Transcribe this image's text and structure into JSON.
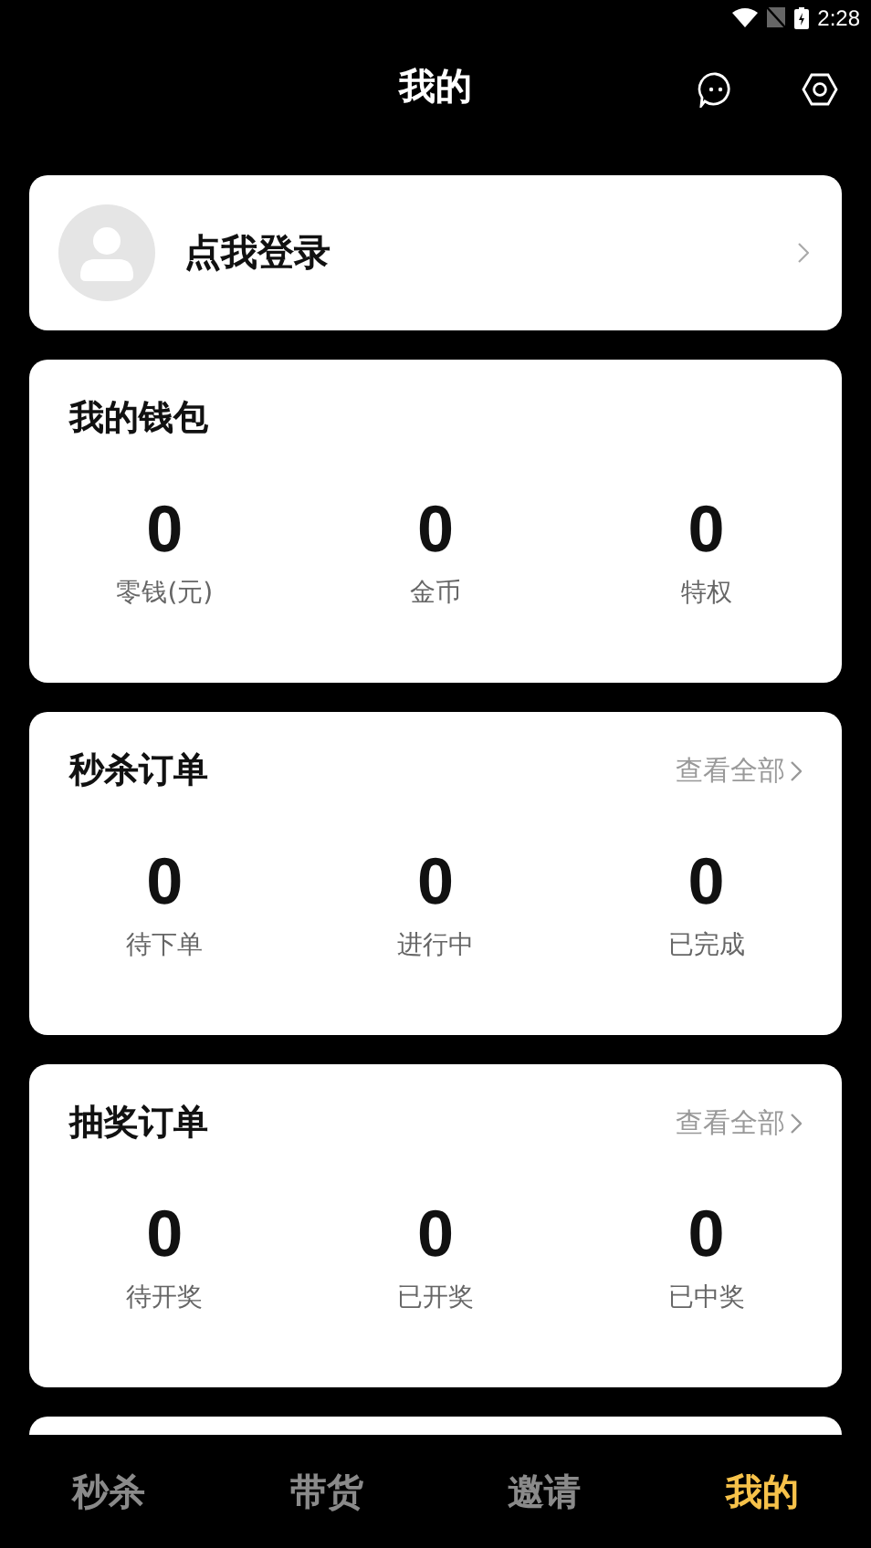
{
  "status_bar": {
    "time": "2:28"
  },
  "header": {
    "title": "我的"
  },
  "login": {
    "label": "点我登录"
  },
  "sections": [
    {
      "title": "我的钱包",
      "stats": [
        {
          "value": "0",
          "label": "零钱(元)"
        },
        {
          "value": "0",
          "label": "金币"
        },
        {
          "value": "0",
          "label": "特权"
        }
      ]
    },
    {
      "title": "秒杀订单",
      "link": "查看全部",
      "stats": [
        {
          "value": "0",
          "label": "待下单"
        },
        {
          "value": "0",
          "label": "进行中"
        },
        {
          "value": "0",
          "label": "已完成"
        }
      ]
    },
    {
      "title": "抽奖订单",
      "link": "查看全部",
      "stats": [
        {
          "value": "0",
          "label": "待开奖"
        },
        {
          "value": "0",
          "label": "已开奖"
        },
        {
          "value": "0",
          "label": "已中奖"
        }
      ]
    }
  ],
  "tabs": [
    {
      "label": "秒杀",
      "selected": false
    },
    {
      "label": "带货",
      "selected": false
    },
    {
      "label": "邀请",
      "selected": false
    },
    {
      "label": "我的",
      "selected": true
    }
  ]
}
